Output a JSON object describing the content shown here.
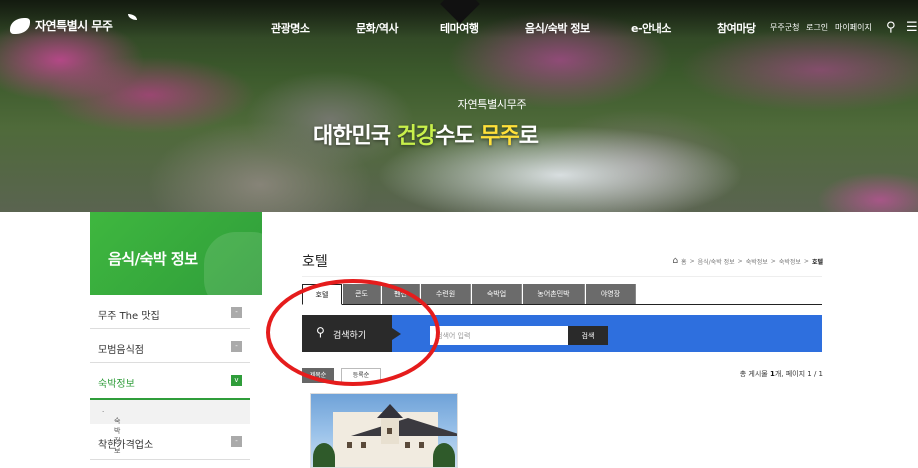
{
  "header": {
    "logo_text": "자연특별시 무주",
    "nav": [
      "관광명소",
      "문화/역사",
      "테마여행",
      "음식/숙박 정보",
      "e-안내소",
      "참여마당"
    ],
    "util_links": [
      "무주군청",
      "로그인",
      "마이페이지"
    ],
    "icons": [
      "search-icon",
      "menu-icon"
    ]
  },
  "hero": {
    "subtitle": "자연특별시무주",
    "title_part1": "대한민국 ",
    "title_part2": "건강",
    "title_part3": "수도 ",
    "title_part4": "무주",
    "title_part5": "로"
  },
  "sidebar": {
    "title": "음식/숙박 정보",
    "items": [
      {
        "label": "무주 The 맛집",
        "toggle": "-"
      },
      {
        "label": "모범음식점",
        "toggle": "-"
      },
      {
        "label": "숙박정보",
        "toggle": "v"
      },
      {
        "label": "착한가격업소",
        "toggle": "-"
      }
    ],
    "sub_item": "숙박정보"
  },
  "content": {
    "title": "호텔",
    "breadcrumb": [
      "홈",
      "음식/숙박 정보",
      "숙박정보",
      "숙박정보",
      "호텔"
    ],
    "tabs": [
      "호텔",
      "콘도",
      "펜션",
      "수련원",
      "숙박업",
      "농어촌민박",
      "야영장"
    ],
    "active_tab": 0,
    "search": {
      "label": "검색하기",
      "placeholder": "검색어 입력",
      "button": "검색"
    },
    "sort": [
      "제목순",
      "등록순"
    ],
    "count_prefix": "총 게시물 ",
    "count_value": "1",
    "count_suffix": "개, 페이지 1 / 1"
  },
  "colors": {
    "accent_green": "#2f9d3a",
    "search_blue": "#2e6fde",
    "annotation_red": "#e51c1c"
  }
}
